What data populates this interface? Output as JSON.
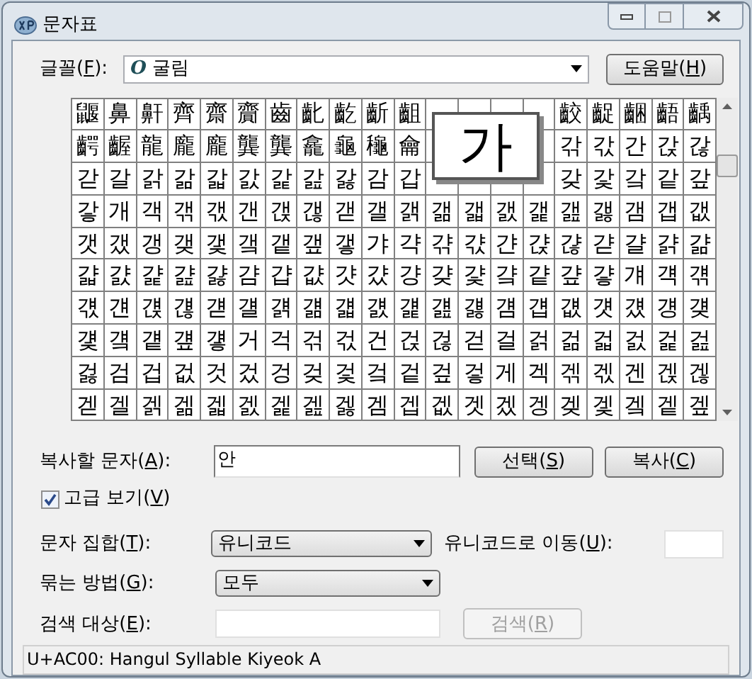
{
  "window": {
    "title": "문자표"
  },
  "font": {
    "label": "글꼴(",
    "mnemonic": "F",
    "label_end": "):",
    "value": "굴림",
    "icon": "O"
  },
  "help_button": {
    "label": "도움말(",
    "mnemonic": "H",
    "label_end": ")"
  },
  "grid": {
    "rows": [
      [
        "鼴",
        "鼻",
        "鼾",
        "齊",
        "齋",
        "齎",
        "齒",
        "齔",
        "齕",
        "齗",
        "齟",
        null,
        null,
        null,
        null,
        "齩",
        "齪",
        "齫",
        "齬",
        "齲"
      ],
      [
        "齶",
        "齷",
        "龍",
        "龐",
        "龐",
        "龔",
        "龔",
        "龕",
        "龜",
        "龝",
        "龠",
        null,
        null,
        null,
        null,
        "갂",
        "갃",
        "간",
        "갅",
        "갆"
      ],
      [
        "갇",
        "갈",
        "갉",
        "갊",
        "갋",
        "갌",
        "갍",
        "갎",
        "갏",
        "감",
        "갑",
        null,
        null,
        null,
        null,
        "갖",
        "갗",
        "갘",
        "같",
        "갚"
      ],
      [
        "갛",
        "개",
        "객",
        "갞",
        "갟",
        "갠",
        "갡",
        "갢",
        "갣",
        "갤",
        "갥",
        "갦",
        "갧",
        "갨",
        "갩",
        "갪",
        "갫",
        "갬",
        "갭",
        "갮"
      ],
      [
        "갯",
        "갰",
        "갱",
        "갲",
        "갳",
        "갴",
        "갵",
        "갶",
        "갷",
        "갸",
        "갹",
        "갺",
        "갻",
        "갼",
        "갽",
        "갾",
        "갿",
        "걀",
        "걁",
        "걂"
      ],
      [
        "걃",
        "걄",
        "걅",
        "걆",
        "걇",
        "걈",
        "걉",
        "걊",
        "걋",
        "걌",
        "걍",
        "걎",
        "걏",
        "걐",
        "걑",
        "걒",
        "걓",
        "걔",
        "걕",
        "걖"
      ],
      [
        "걗",
        "걘",
        "걙",
        "걚",
        "걛",
        "걜",
        "걝",
        "걞",
        "걟",
        "걠",
        "걡",
        "걢",
        "걣",
        "걤",
        "걥",
        "걦",
        "걧",
        "걨",
        "걩",
        "걪"
      ],
      [
        "걫",
        "걬",
        "걭",
        "걮",
        "걯",
        "거",
        "걱",
        "걲",
        "걳",
        "건",
        "걵",
        "걶",
        "걷",
        "걸",
        "걹",
        "걺",
        "걻",
        "걼",
        "걽",
        "걾"
      ],
      [
        "걿",
        "검",
        "겁",
        "겂",
        "것",
        "겄",
        "겅",
        "겆",
        "겇",
        "겈",
        "겉",
        "겊",
        "겋",
        "게",
        "겍",
        "겎",
        "겏",
        "겐",
        "겑",
        "겒"
      ],
      [
        "겓",
        "겔",
        "겕",
        "겖",
        "겗",
        "겘",
        "겙",
        "겚",
        "겛",
        "겜",
        "겝",
        "겞",
        "겟",
        "겠",
        "겡",
        "겢",
        "겣",
        "겤",
        "겥",
        "겦"
      ]
    ],
    "magnifier": "가"
  },
  "copy": {
    "label": "복사할 문자(",
    "mnemonic": "A",
    "label_end": "):",
    "value": "안"
  },
  "select_button": {
    "label": "선택(",
    "mnemonic": "S",
    "label_end": ")"
  },
  "copy_button": {
    "label": "복사(",
    "mnemonic": "C",
    "label_end": ")"
  },
  "advanced": {
    "label": "고급 보기(",
    "mnemonic": "V",
    "label_end": ")",
    "checked": true
  },
  "charset": {
    "label": "문자 집합(",
    "mnemonic": "T",
    "label_end": "):",
    "value": "유니코드"
  },
  "goto_unicode": {
    "label": "유니코드로 이동(",
    "mnemonic": "U",
    "label_end": "):"
  },
  "group_by": {
    "label": "묶는 방법(",
    "mnemonic": "G",
    "label_end": "):",
    "value": "모두"
  },
  "search": {
    "label": "검색 대상(",
    "mnemonic": "E",
    "label_end": "):"
  },
  "search_button": {
    "label": "검색(",
    "mnemonic": "R",
    "label_end": ")",
    "disabled": true
  },
  "status_bar": "U+AC00: Hangul Syllable Kiyeok A"
}
